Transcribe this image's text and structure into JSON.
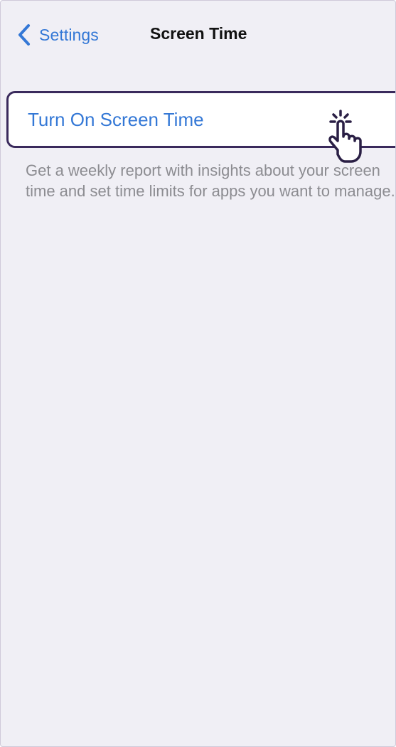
{
  "nav": {
    "back_label": "Settings",
    "back_icon": "chevron-left-icon",
    "title": "Screen Time"
  },
  "screen_time": {
    "action_label": "Turn On Screen Time",
    "description": "Get a weekly report with insights about your screen time and set time limits for apps you want to manage.",
    "pointer_icon": "tap-hand-icon"
  },
  "colors": {
    "accent": "#3478d6",
    "background": "#f0eff5",
    "highlight_outline": "#3a2a5c",
    "secondary_text": "#8c8c91"
  }
}
